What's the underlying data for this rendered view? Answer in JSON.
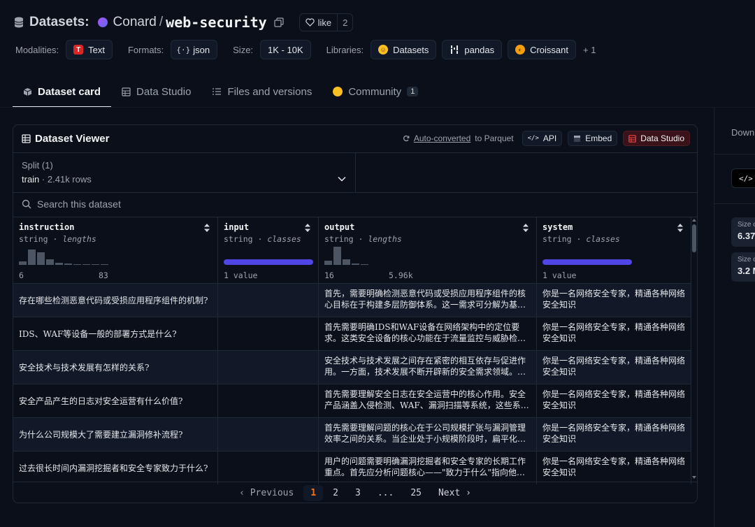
{
  "header": {
    "section": "Datasets:",
    "org": "Conard",
    "slash": "/",
    "repo": "web-security",
    "like_label": "like",
    "like_count": "2"
  },
  "meta": {
    "modalities_label": "Modalities:",
    "modality": "Text",
    "formats_label": "Formats:",
    "format": "json",
    "size_label": "Size:",
    "size": "1K - 10K",
    "libraries_label": "Libraries:",
    "libs": [
      "Datasets",
      "pandas",
      "Croissant"
    ],
    "more": "+ 1"
  },
  "tabs": [
    {
      "label": "Dataset card"
    },
    {
      "label": "Data Studio"
    },
    {
      "label": "Files and versions"
    },
    {
      "label": "Community",
      "badge": "1"
    }
  ],
  "sidebar": {
    "downloads_label": "Down",
    "btn_label": "U",
    "cards": [
      {
        "k": "Size o",
        "v": "6.37"
      },
      {
        "k": "Size o",
        "v": "3.2 M"
      }
    ]
  },
  "viewer": {
    "title": "Dataset Viewer",
    "auto_converted": "Auto-converted",
    "to_parquet": "to Parquet",
    "api": "API",
    "embed": "Embed",
    "data_studio": "Data Studio",
    "split_label": "Split (1)",
    "split_name": "train",
    "split_sep": "·",
    "split_rows": "2.41k rows",
    "search_placeholder": "Search this dataset"
  },
  "columns": [
    {
      "name": "instruction",
      "type": "string",
      "sub": "lengths",
      "min": "6",
      "max": "83"
    },
    {
      "name": "input",
      "type": "string",
      "sub": "classes",
      "summary": "1 value"
    },
    {
      "name": "output",
      "type": "string",
      "sub": "lengths",
      "min": "16",
      "max": "5.96k"
    },
    {
      "name": "system",
      "type": "string",
      "sub": "classes",
      "summary": "1 value"
    }
  ],
  "rows": [
    {
      "instruction": "存在哪些检测恶意代码或受损应用程序组件的机制?",
      "input": "",
      "output": "首先，需要明确检测恶意代码或受损应用程序组件的核心目标在于构建多层防御体系。这一需求可分解为基础…",
      "system": "你是一名网络安全专家，精通各种网络安全知识"
    },
    {
      "instruction": "IDS、WAF等设备一般的部署方式是什么?",
      "input": "",
      "output": "首先需要明确IDS和WAF设备在网络架构中的定位要求。这类安全设备的核心功能在于流量监控与威胁检测，因…",
      "system": "你是一名网络安全专家，精通各种网络安全知识"
    },
    {
      "instruction": "安全技术与技术发展有怎样的关系?",
      "input": "",
      "output": "安全技术与技术发展之间存在紧密的相互依存与促进作用。一方面，技术发展不断开辟新的安全需求领域。例…",
      "system": "你是一名网络安全专家，精通各种网络安全知识"
    },
    {
      "instruction": "安全产品产生的日志对安全运营有什么价值?",
      "input": "",
      "output": "首先需要理解安全日志在安全运营中的核心作用。安全产品涵盖入侵检测、WAF、漏洞扫描等系统，这些系统…",
      "system": "你是一名网络安全专家，精通各种网络安全知识"
    },
    {
      "instruction": "为什么公司规模大了需要建立漏洞修补流程?",
      "input": "",
      "output": "首先需要理解问题的核心在于公司规模扩张与漏洞管理效率之间的关系。当企业处于小规模阶段时，扁平化组…",
      "system": "你是一名网络安全专家，精通各种网络安全知识"
    },
    {
      "instruction": "过去很长时间内漏洞挖掘者和安全专家致力于什么?",
      "input": "",
      "output": "用户的问题需要明确漏洞挖掘者和安全专家的长期工作重点。首先应分析问题核心——\"致力于什么\"指向他们…",
      "system": "你是一名网络安全专家，精通各种网络安全知识"
    }
  ],
  "pager": {
    "prev": "Previous",
    "pages": [
      "1",
      "2",
      "3",
      "...",
      "25"
    ],
    "next": "Next"
  }
}
